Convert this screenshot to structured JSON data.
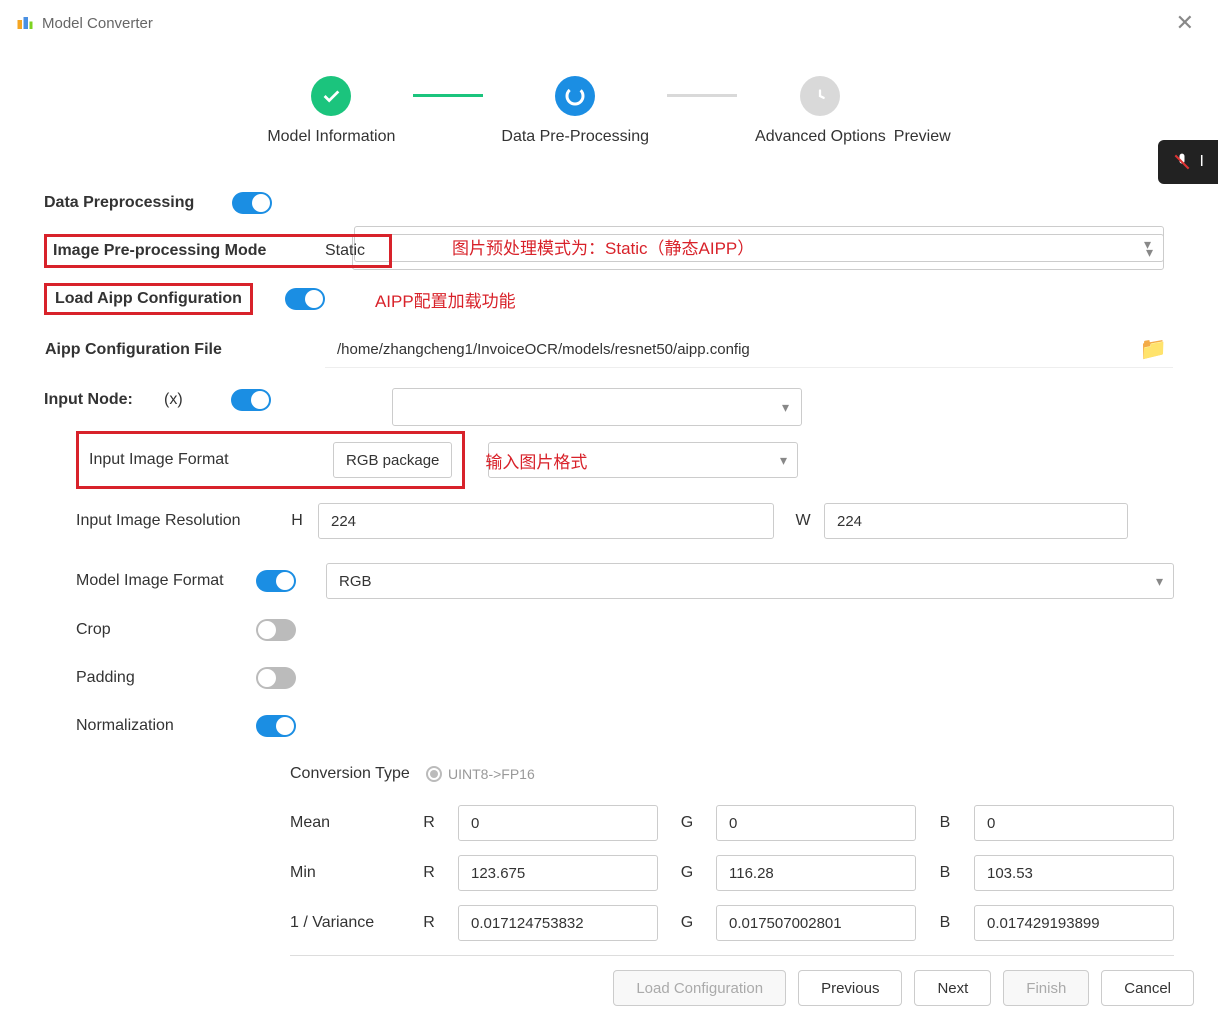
{
  "window": {
    "title": "Model Converter"
  },
  "steps": {
    "s1": "Model Information",
    "s2": "Data Pre-Processing",
    "s3": "Advanced Options",
    "s4": "Preview"
  },
  "labels": {
    "data_preprocessing": "Data Preprocessing",
    "image_preproc_mode": "Image Pre-processing Mode",
    "load_aipp": "Load Aipp Configuration",
    "aipp_file": "Aipp Configuration File",
    "input_node": "Input Node:",
    "input_node_x": "(x)",
    "input_image_format": "Input Image Format",
    "input_image_res": "Input Image Resolution",
    "model_image_format": "Model Image Format",
    "crop": "Crop",
    "padding": "Padding",
    "normalization": "Normalization",
    "conversion_type": "Conversion Type",
    "mean": "Mean",
    "min": "Min",
    "variance": "1 / Variance",
    "H": "H",
    "W": "W",
    "R": "R",
    "G": "G",
    "B": "B"
  },
  "values": {
    "mode": "Static",
    "aipp_path": "/home/zhangcheng1/InvoiceOCR/models/resnet50/aipp.config",
    "input_format": "RGB package",
    "res_h": "224",
    "res_w": "224",
    "model_format": "RGB",
    "conv_type": "UINT8->FP16",
    "mean_r": "0",
    "mean_g": "0",
    "mean_b": "0",
    "min_r": "123.675",
    "min_g": "116.28",
    "min_b": "103.53",
    "var_r": "0.017124753832",
    "var_g": "0.017507002801",
    "var_b": "0.017429193899"
  },
  "annotations": {
    "mode_note": "图片预处理模式为：Static（静态AIPP）",
    "aipp_note": "AIPP配置加载功能",
    "format_note": "输入图片格式"
  },
  "buttons": {
    "load_config": "Load Configuration",
    "previous": "Previous",
    "next": "Next",
    "finish": "Finish",
    "cancel": "Cancel"
  }
}
